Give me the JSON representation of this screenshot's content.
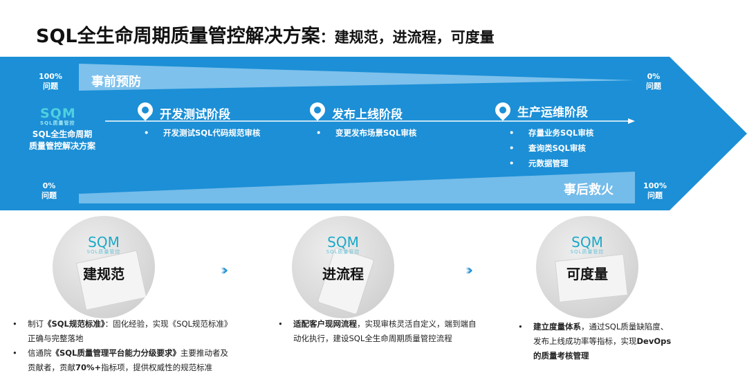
{
  "header": {
    "title": "SQL全生命周期质量管控解决方案",
    "subtitle": "：建规范，进流程，可度量"
  },
  "band": {
    "top_left_pct": "100%",
    "top_left_unit": "问题",
    "top_right_pct": "0%",
    "top_right_unit": "问题",
    "bottom_left_pct": "0%",
    "bottom_left_unit": "问题",
    "bottom_right_pct": "100%",
    "bottom_right_unit": "问题",
    "prevention_label": "事前预防",
    "remedy_label": "事后救火",
    "logo_text": "SQM",
    "logo_sub": "SQL质量管控",
    "caption_line1": "SQL全生命周期",
    "caption_line2": "质量管控解决方案",
    "stages": [
      {
        "title": "开发测试阶段",
        "items": [
          "开发测试SQL代码规范审核"
        ]
      },
      {
        "title": "发布上线阶段",
        "items": [
          "变更发布场景SQL审核"
        ]
      },
      {
        "title": "生产运维阶段",
        "items": [
          "存量业务SQL审核",
          "查询类SQL审核",
          "元数据管理"
        ]
      }
    ]
  },
  "pillars": [
    {
      "logo_text": "SQM",
      "logo_sub": "SQL质量管控",
      "label": "建规范"
    },
    {
      "logo_text": "SQM",
      "logo_sub": "SQL质量管控",
      "label": "进流程"
    },
    {
      "logo_text": "SQM",
      "logo_sub": "SQL质量管控",
      "label": "可度量"
    }
  ],
  "chevron": "››››",
  "details": {
    "col1": [
      {
        "pre": "制订",
        "bold": "《SQL规范标准》",
        "post": "：固化经验，实现《SQL规范标准》正确与完整落地"
      },
      {
        "pre": "信通院",
        "bold": "《SQL质量管理平台能力分级要求》",
        "post": "主要推动者及贡献者，贡献",
        "bold2": "70%+",
        "post2": "指标项，提供权威性的规范标准"
      }
    ],
    "col2": [
      {
        "bold": "适配客户现网流程",
        "post": "，实现审核灵活自定义，端到端自动化执行，建设SQL全生命周期质量管控流程"
      }
    ],
    "col3": [
      {
        "bold": "建立度量体系",
        "post": "，通过SQL质量缺陷度、发布上线成功率等指标，实现",
        "bold2": "DevOps的质量考核管理"
      }
    ]
  },
  "colors": {
    "band_blue": "#1c8fd6",
    "wedge_light": "#7ec1ec",
    "accent_cyan": "#4fd0e0"
  }
}
